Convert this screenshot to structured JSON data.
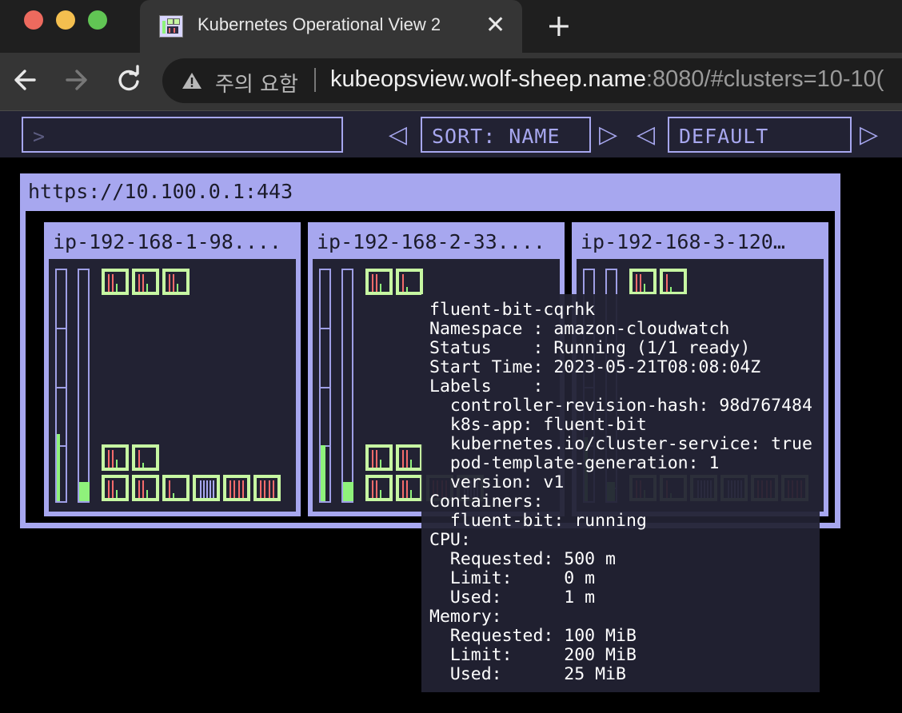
{
  "browser": {
    "tab_title": "Kubernetes Operational View 2",
    "close_glyph": "✕",
    "new_tab_glyph": "+",
    "security_warning": "주의 요함",
    "url_host": "kubeopsview.wolf-sheep.name",
    "url_rest": ":8080/#clusters=10-10("
  },
  "app": {
    "filter_placeholder": ">",
    "sort_label": "SORT: NAME",
    "theme_label": "DEFAULT",
    "arrow_left": "◁",
    "arrow_right": "▷"
  },
  "cluster": {
    "title": "https://10.100.0.1:443",
    "nodes": [
      {
        "title": "ip-192-168-1-98...."
      },
      {
        "title": "ip-192-168-2-33...."
      },
      {
        "title": "ip-192-168-3-120…"
      }
    ]
  },
  "tooltip": {
    "lines": [
      "fluent-bit-cqrhk",
      "Namespace : amazon-cloudwatch",
      "Status    : Running (1/1 ready)",
      "Start Time: 2023-05-21T08:08:04Z",
      "Labels    :",
      "  controller-revision-hash: 98d767484",
      "  k8s-app: fluent-bit",
      "  kubernetes.io/cluster-service: true",
      "  pod-template-generation: 1",
      "  version: v1",
      "Containers:",
      "  fluent-bit: running",
      "CPU:",
      "  Requested: 500 m",
      "  Limit:     0 m",
      "  Used:      1 m",
      "Memory:",
      "  Requested: 100 MiB",
      "  Limit:     200 MiB",
      "  Used:      25 MiB"
    ]
  },
  "colors": {
    "accent": "#a7a7ef",
    "panel": "#222233",
    "pod_running": "#c7f7a2",
    "usage": "#8ff27b",
    "cpu_bar": "#f56b6b"
  },
  "icons": [
    "back-arrow-icon",
    "forward-arrow-icon",
    "reload-icon",
    "warning-icon",
    "close-icon",
    "plus-icon"
  ]
}
